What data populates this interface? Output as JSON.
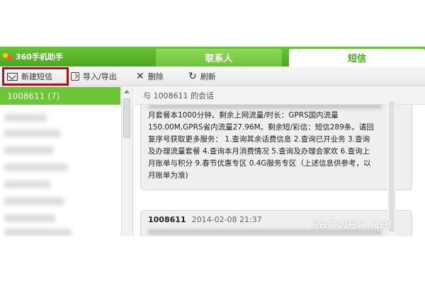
{
  "app": {
    "title": "360手机助手"
  },
  "tabs": [
    {
      "label": "联系人",
      "active": false
    },
    {
      "label": "短信",
      "active": true
    }
  ],
  "toolbar": {
    "new_label": "新建短信",
    "import_label": "导入/导出",
    "delete_label": "删除",
    "refresh_label": "刷新"
  },
  "sidebar": {
    "selected_contact": "1008611 (7)"
  },
  "conversation": {
    "header": "与 1008611 的会话",
    "message_1_lines": [
      "月套餐本1000分钟。剩余上网流量/时长：GPRS国内流量",
      "150.00M,GPRS省内流量27.96M。剩余短/彩信：短信289条。请回",
      "复序号获取更多服务： 1.查询其余话费信息 2.查询已开业务 3.查询",
      "及办理流量套餐 4.查询本月消费情况 5.查询及办理会家欢 6.查询上",
      "月账单与积分 9.春节优惠专区 0.4G服务专区（上述信息供参考，以",
      "月账单为准)"
    ],
    "message_2_sender": "1008611",
    "message_2_date": "2014-02-08 21:37"
  },
  "watermark": "sanwen.net",
  "colors": {
    "accent": "#6cc437",
    "highlight_border": "#a8161c"
  }
}
